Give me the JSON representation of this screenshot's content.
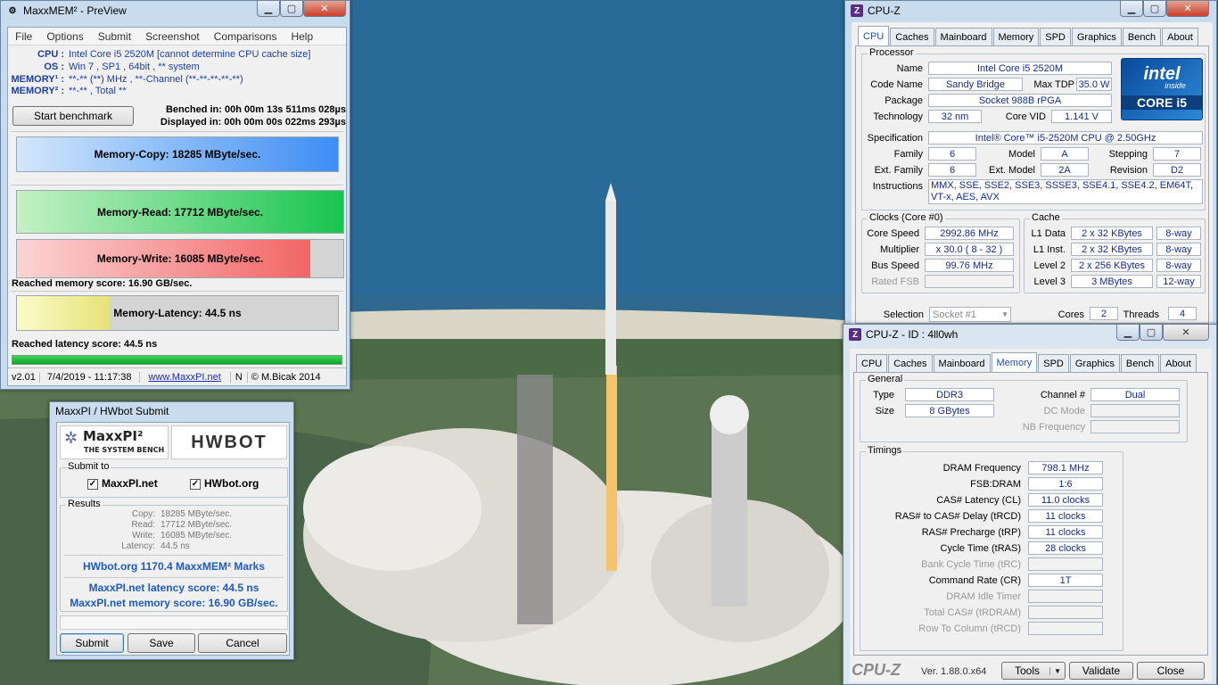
{
  "maxxmem": {
    "title": "MaxxMEM² - PreView",
    "menu": [
      "File",
      "Options",
      "Submit",
      "Screenshot",
      "Comparisons",
      "Help"
    ],
    "cpu_label": "CPU :",
    "cpu_value": "Intel Core i5 2520M  [cannot determine CPU cache size]",
    "os_label": "OS :",
    "os_value": "Win 7 , SP1 , 64bit , ** system",
    "mem1_label": "MEMORY¹ :",
    "mem1_value": "**-** (**) MHz , **-Channel (**-**-**-**-**)",
    "mem2_label": "MEMORY² :",
    "mem2_value": "**-** , Total **",
    "start_button": "Start benchmark",
    "benched": "Benched in: 00h 00m 13s 511ms 028µs",
    "displayed": "Displayed in: 00h 00m 00s 022ms 293µs",
    "copy": {
      "text": "Memory-Copy: 18285 MByte/sec.",
      "fill": 1.0
    },
    "read": {
      "text": "Memory-Read: 17712 MByte/sec.",
      "fill": 1.0
    },
    "write": {
      "text": "Memory-Write: 16085 MByte/sec.",
      "fill": 0.9
    },
    "mem_score": "Reached memory score: 16.90 GB/sec.",
    "latency": {
      "text": "Memory-Latency: 44.5 ns",
      "fill": 0.29
    },
    "lat_score": "Reached latency score: 44.5 ns",
    "status": {
      "version": "v2.01",
      "date": "7/4/2019 - 11:17:38",
      "link": "www.MaxxPI.net",
      "n": "N",
      "copy": "© M.Bicak 2014"
    }
  },
  "hwbot": {
    "title": "MaxxPI / HWbot Submit",
    "logo1": "MaxxPI²",
    "logo1_sub": "THE SYSTEM BENCH",
    "logo2": "HWBOT",
    "submit_to": "Submit to",
    "opt1": "MaxxPI.net",
    "opt2": "HWbot.org",
    "results_label": "Results",
    "results": [
      {
        "k": "Copy:",
        "v": "18285 MByte/sec."
      },
      {
        "k": "Read:",
        "v": "17712 MByte/sec."
      },
      {
        "k": "Write:",
        "v": "16085 MByte/sec."
      },
      {
        "k": "Latency:",
        "v": "44.5 ns"
      }
    ],
    "marks": "HWbot.org  1170.4  MaxxMEM² Marks",
    "lat_score": "MaxxPI.net latency score:  44.5  ns",
    "mem_score": "MaxxPI.net memory score:  16.90  GB/sec.",
    "btn_submit": "Submit",
    "btn_save": "Save",
    "btn_cancel": "Cancel"
  },
  "cpuz1": {
    "title": "CPU-Z",
    "tabs": [
      "CPU",
      "Caches",
      "Mainboard",
      "Memory",
      "SPD",
      "Graphics",
      "Bench",
      "About"
    ],
    "processor": "Processor",
    "name_l": "Name",
    "name": "Intel Core i5 2520M",
    "code_l": "Code Name",
    "code": "Sandy Bridge",
    "tdp_l": "Max TDP",
    "tdp": "35.0 W",
    "pkg_l": "Package",
    "pkg": "Socket 988B rPGA",
    "tech_l": "Technology",
    "tech": "32 nm",
    "vid_l": "Core VID",
    "vid": "1.141 V",
    "spec_l": "Specification",
    "spec": "Intel® Core™ i5-2520M CPU @ 2.50GHz",
    "fam_l": "Family",
    "fam": "6",
    "mod_l": "Model",
    "mod": "A",
    "step_l": "Stepping",
    "step": "7",
    "efam_l": "Ext. Family",
    "efam": "6",
    "emod_l": "Ext. Model",
    "emod": "2A",
    "rev_l": "Revision",
    "rev": "D2",
    "ins_l": "Instructions",
    "ins": "MMX, SSE, SSE2, SSE3, SSSE3, SSE4.1, SSE4.2, EM64T, VT-x, AES, AVX",
    "clocks": "Clocks (Core #0)",
    "cache": "Cache",
    "cs_l": "Core Speed",
    "cs": "2992.86 MHz",
    "mul_l": "Multiplier",
    "mul": "x 30.0 ( 8 - 32 )",
    "bus_l": "Bus Speed",
    "bus": "99.76 MHz",
    "fsb_l": "Rated FSB",
    "l1d_l": "L1 Data",
    "l1d": "2 x 32 KBytes",
    "l1d_w": "8-way",
    "l1i_l": "L1 Inst.",
    "l1i": "2 x 32 KBytes",
    "l1i_w": "8-way",
    "l2_l": "Level 2",
    "l2": "2 x 256 KBytes",
    "l2_w": "8-way",
    "l3_l": "Level 3",
    "l3": "3 MBytes",
    "l3_w": "12-way",
    "sel_l": "Selection",
    "sel": "Socket #1",
    "cores_l": "Cores",
    "cores": "2",
    "thr_l": "Threads",
    "thr": "4",
    "logo_brand": "intel",
    "logo_inside": "inside",
    "logo_core": "CORE i5"
  },
  "cpuz2": {
    "title": "CPU-Z - ID : 4ll0wh",
    "tabs": [
      "CPU",
      "Caches",
      "Mainboard",
      "Memory",
      "SPD",
      "Graphics",
      "Bench",
      "About"
    ],
    "general": "General",
    "type_l": "Type",
    "type": "DDR3",
    "size_l": "Size",
    "size": "8 GBytes",
    "ch_l": "Channel #",
    "ch": "Dual",
    "dc_l": "DC Mode",
    "nb_l": "NB Frequency",
    "timings": "Timings",
    "rows": [
      {
        "l": "DRAM Frequency",
        "v": "798.1 MHz",
        "dis": false
      },
      {
        "l": "FSB:DRAM",
        "v": "1:6",
        "dis": false
      },
      {
        "l": "CAS# Latency (CL)",
        "v": "11.0 clocks",
        "dis": false
      },
      {
        "l": "RAS# to CAS# Delay (tRCD)",
        "v": "11 clocks",
        "dis": false
      },
      {
        "l": "RAS# Precharge (tRP)",
        "v": "11 clocks",
        "dis": false
      },
      {
        "l": "Cycle Time (tRAS)",
        "v": "28 clocks",
        "dis": false
      },
      {
        "l": "Bank Cycle Time (tRC)",
        "v": "",
        "dis": true
      },
      {
        "l": "Command Rate (CR)",
        "v": "1T",
        "dis": false
      },
      {
        "l": "DRAM Idle Timer",
        "v": "",
        "dis": true
      },
      {
        "l": "Total CAS# (tRDRAM)",
        "v": "",
        "dis": true
      },
      {
        "l": "Row To Column (tRCD)",
        "v": "",
        "dis": true
      }
    ],
    "brand": "CPU-Z",
    "version": "Ver. 1.88.0.x64",
    "tools": "Tools",
    "validate": "Validate",
    "close": "Close"
  }
}
